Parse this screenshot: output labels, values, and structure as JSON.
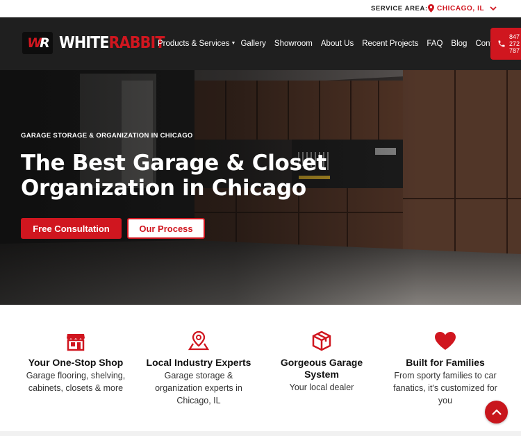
{
  "top_bar": {
    "service_area_label": "SERVICE AREA:",
    "city": "CHICAGO, IL"
  },
  "brand": {
    "logo_mark": "WR",
    "name_part1": "WHITE",
    "name_part2": "RABBIT",
    "accent_color": "#d0161f",
    "nav_bg": "#1f1f1f"
  },
  "nav": {
    "items": [
      {
        "label": "Products & Services",
        "has_dropdown": true
      },
      {
        "label": "Gallery"
      },
      {
        "label": "Showroom"
      },
      {
        "label": "About Us"
      },
      {
        "label": "Recent Projects"
      },
      {
        "label": "FAQ"
      },
      {
        "label": "Blog"
      },
      {
        "label": "Contact"
      }
    ],
    "phone": "847\n272\n787"
  },
  "hero": {
    "kicker": "GARAGE STORAGE & ORGANIZATION IN CHICAGO",
    "title": "The Best Garage & Closet Organization in Chicago",
    "primary_cta": "Free Consultation",
    "secondary_cta": "Our Process"
  },
  "features": [
    {
      "icon": "storefront-icon",
      "title": "Your One-Stop Shop",
      "description": "Garage flooring, shelving, cabinets, closets & more"
    },
    {
      "icon": "map-pin-icon",
      "title": "Local Industry Experts",
      "description": "Garage storage & organization experts in Chicago, IL"
    },
    {
      "icon": "gift-box-icon",
      "title": "Gorgeous Garage System",
      "description": "Your local dealer"
    },
    {
      "icon": "heart-icon",
      "title": "Built for Families",
      "description": "From sporty families to car fanatics, it's customized for you"
    }
  ]
}
